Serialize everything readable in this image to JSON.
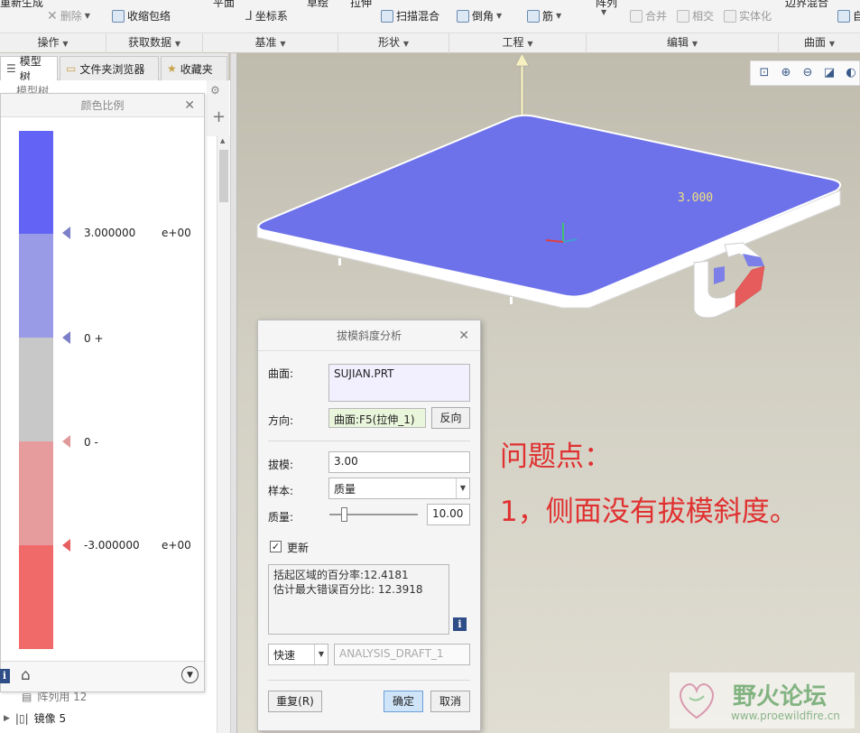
{
  "ribbon": {
    "top_partial": [
      {
        "id": "regen",
        "label": "重新生成"
      },
      {
        "id": "plane",
        "label": "平面"
      },
      {
        "id": "sketch",
        "label": "草绘"
      },
      {
        "id": "extrude",
        "label": "拉伸"
      },
      {
        "id": "pattern",
        "label": "阵列"
      },
      {
        "id": "boundary",
        "label": "边界混合"
      }
    ],
    "commands": {
      "delete": "删除",
      "shrinkwrap": "收缩包络",
      "csys": "坐标系",
      "sweep_blend": "扫描混合",
      "round": "倒角",
      "rib": "筋",
      "merge": "合并",
      "intersect": "相交",
      "solidify": "实体化",
      "auto": "自"
    },
    "groups": [
      "操作",
      "获取数据",
      "基准",
      "形状",
      "工程",
      "编辑",
      "曲面"
    ]
  },
  "left_panel": {
    "tabs": [
      "模型树",
      "文件夹浏览器",
      "收藏夹"
    ],
    "tree_items": [
      {
        "label": "模型树",
        "partial": true
      },
      {
        "label": "阵列用 12",
        "partial": true
      },
      {
        "label": "镜像 5"
      }
    ]
  },
  "color_scale": {
    "title": "颜色比例",
    "markers": [
      {
        "value": "3.000000",
        "exp": "e+00"
      },
      {
        "value": "0 +",
        "exp": ""
      },
      {
        "value": "0 -",
        "exp": ""
      },
      {
        "value": "-3.000000",
        "exp": "e+00"
      }
    ],
    "colors": {
      "band1": "#6363f5",
      "band2": "#9a9be6",
      "band3": "#c8c8c8",
      "band4": "#e69c9c",
      "band5": "#f06a6a"
    },
    "footer_icons": [
      "info-icon",
      "home-icon",
      "chevron-down-icon"
    ]
  },
  "viewport": {
    "dimension_label": "3.000",
    "toolbar_icons": [
      "zoom-fit-icon",
      "zoom-in-icon",
      "zoom-out-icon",
      "repaint-icon",
      "display-style-icon"
    ],
    "annotation_line1": "问题点：",
    "annotation_line2": "1，侧面没有拔模斜度。",
    "annotation_color": "#e03030",
    "surface_color": "#6e72ea"
  },
  "dialog": {
    "title": "拔模斜度分析",
    "surface_label": "曲面:",
    "surface_value": "SUJIAN.PRT",
    "direction_label": "方向:",
    "direction_value": "曲面:F5(拉伸_1)",
    "reverse_button": "反向",
    "draft_label": "拔模:",
    "draft_value": "3.00",
    "sample_label": "样本:",
    "sample_value": "质量",
    "quality_label": "质量:",
    "quality_value": "10.00",
    "quality_level": 0.05,
    "update_label": "更新",
    "update_checked": "✓",
    "result_line1": "括起区域的百分率:12.4181",
    "result_line2": "估计最大错误百分比: 12.3918",
    "mode_value": "快速",
    "analysis_name": "ANALYSIS_DRAFT_1",
    "repeat_button": "重复(R)",
    "ok_button": "确定",
    "cancel_button": "取消"
  },
  "watermark": {
    "title": "野火论坛",
    "url": "www.proewildfire.cn"
  }
}
